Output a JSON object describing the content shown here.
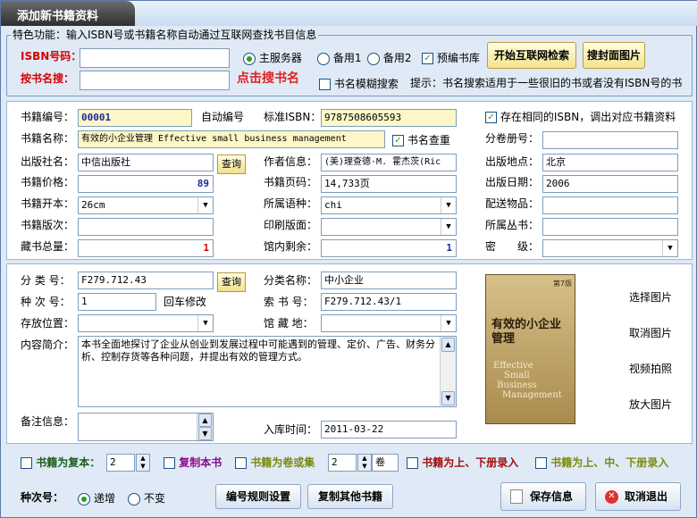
{
  "window": {
    "title": "添加新书籍资料"
  },
  "feature": {
    "legend": "特色功能：输入ISBN号或书籍名称自动通过互联网查找书目信息",
    "isbn_label": "ISBN号码：",
    "isbn_value": "",
    "search_label": "按书名搜：",
    "search_value": "",
    "search_hint": "点击搜书名",
    "server_options": [
      "主服务器",
      "备用1",
      "备用2"
    ],
    "server_selected": "主服务器",
    "prelib_label": "预编书库",
    "prelib_checked": true,
    "fuzzy_label": "书名模糊搜索",
    "fuzzy_checked": false,
    "tip": "提示：书名搜索适用于一些很旧的书或者没有ISBN号的书",
    "btn_search": "开始互联网检索",
    "btn_cover": "搜封面图片"
  },
  "book": {
    "id_label": "书籍编号：",
    "id_value": "00001",
    "auto_label": "自动编号",
    "isbn_label": "标准ISBN：",
    "isbn_value": "9787508605593",
    "same_isbn_label": "存在相同的ISBN，调出对应书籍资料",
    "same_isbn_checked": true,
    "name_label": "书籍名称：",
    "name_value": "有效的小企业管理 Effective small business management",
    "dupcheck_label": "书名查重",
    "dupcheck_checked": true,
    "volume_label": "分卷册号：",
    "volume_value": "",
    "publisher_label": "出版社名：",
    "publisher_value": "中信出版社",
    "lookup_label": "查询",
    "author_label": "作者信息：",
    "author_value": "(美)理查德·M. 霍杰茨(Ric",
    "place_label": "出版地点：",
    "place_value": "北京",
    "price_label": "书籍价格：",
    "price_value": "89",
    "pages_label": "书籍页码：",
    "pages_value": "14,733页",
    "date_label": "出版日期：",
    "date_value": "2006",
    "format_label": "书籍开本：",
    "format_value": "26cm",
    "lang_label": "所属语种：",
    "lang_value": "chi",
    "attach_label": "配送物品：",
    "attach_value": "",
    "edition_label": "书籍版次：",
    "edition_value": "",
    "print_label": "印刷版面：",
    "print_value": "",
    "series_label": "所属丛书：",
    "series_value": "",
    "total_label": "藏书总量：",
    "total_value": "1",
    "remain_label": "馆内剩余：",
    "remain_value": "1",
    "secret_label": "密　　级：",
    "secret_value": ""
  },
  "classify": {
    "class_label": "分 类 号：",
    "class_value": "F279.712.43",
    "lookup_label": "查询",
    "classname_label": "分类名称：",
    "classname_value": "中小企业",
    "seq_label": "种 次 号：",
    "seq_value": "1",
    "enter_label": "回车修改",
    "callno_label": "索 书 号：",
    "callno_value": "F279.712.43/1",
    "location_label": "存放位置：",
    "location_value": "",
    "hall_label": "馆 藏 地：",
    "hall_value": "",
    "summary_label": "内容简介：",
    "summary_value": "本书全面地探讨了企业从创业到发展过程中可能遇到的管理、定价、广告、财务分析、控制存货等各种问题，并提出有效的管理方式。",
    "remark_label": "备注信息：",
    "remark_value": "",
    "indate_label": "入库时间：",
    "indate_value": "2011-03-22"
  },
  "image": {
    "cover_title": "有效的小企业管理",
    "cover_en": [
      "Effective",
      "Small",
      "Business",
      "Management"
    ],
    "cover_badge": "第7版",
    "actions": [
      "选择图片",
      "取消图片",
      "视频拍照",
      "放大图片"
    ]
  },
  "copy": {
    "copy_label": "书籍为复本：",
    "copy_count": "2",
    "copy_this": "复制本书",
    "volset_label": "书籍为卷或集",
    "vol_count": "2",
    "vol_unit": "卷",
    "updown_label": "书籍为上、下册录入",
    "updownmid_label": "书籍为上、中、下册录入"
  },
  "footer": {
    "seq_label": "种次号：",
    "seq_options": [
      "递增",
      "不变"
    ],
    "seq_selected": "递增",
    "btn_rule": "编号规则设置",
    "btn_copy_other": "复制其他书籍",
    "btn_save": "保存信息",
    "btn_cancel": "取消退出"
  },
  "colors": {
    "accent": "#d40000",
    "window_bg": "#dfeaf6",
    "check_green": "#21a121",
    "btn_gold": "#f5e48a"
  }
}
